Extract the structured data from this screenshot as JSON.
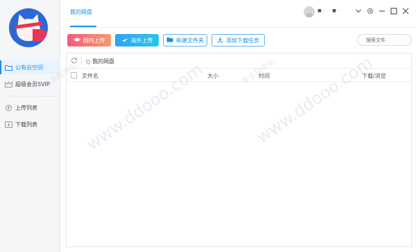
{
  "sidebar": {
    "items": [
      {
        "label": "公有云空间",
        "icon": "folder-icon",
        "active": true
      },
      {
        "label": "超级会员SVIP",
        "icon": "crown-icon",
        "active": false
      },
      {
        "label": "上传列表",
        "icon": "upload-list-icon",
        "active": false
      },
      {
        "label": "下载列表",
        "icon": "download-list-icon",
        "active": false
      }
    ]
  },
  "header": {
    "tab": "我的网盘",
    "username": "■  ·  ·  ■ ·"
  },
  "toolbar": {
    "domestic_upload": "国内上传",
    "overseas_upload": "海外上传",
    "new_folder": "新建文件夹",
    "add_download": "添加下载任务",
    "search_placeholder": "搜索文件"
  },
  "file_panel": {
    "breadcrumb": "我的网盘",
    "columns": {
      "name": "文件名",
      "size": "大小",
      "time": "时间",
      "action": "下载/浏览"
    }
  },
  "watermark": {
    "text": "www.ddooo.com",
    "small_text": "多多软件站"
  },
  "colors": {
    "accent": "#1e8de6",
    "domestic_gradient": [
      "#f25d7e",
      "#f59b6b"
    ],
    "overseas_gradient": [
      "#2fa4f2",
      "#28c6e8"
    ]
  }
}
